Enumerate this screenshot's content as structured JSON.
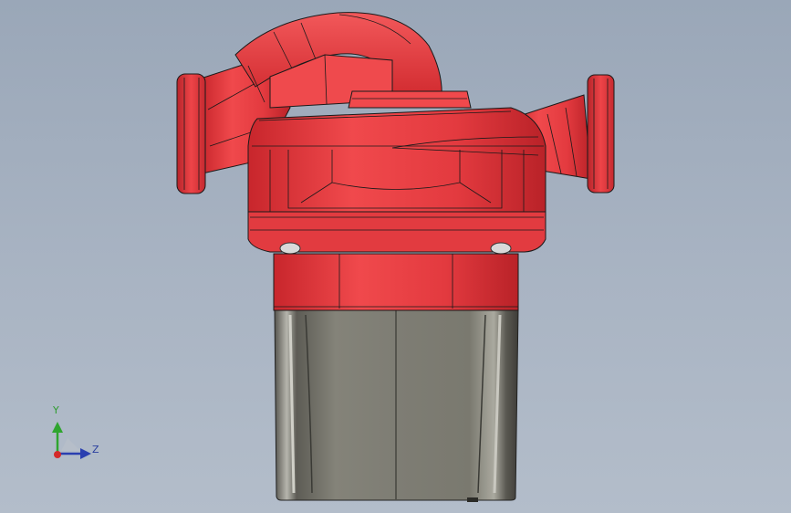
{
  "viewport": {
    "background_top": "#9aa7b8",
    "background_bottom": "#b3bdca"
  },
  "model": {
    "part": "circulation-pump",
    "body_color": "#e8383d",
    "body_shadow_color": "#b8242a",
    "motor_can_color": "#7d7c73"
  },
  "triad": {
    "y_label": "Y",
    "z_label": "Z",
    "y_color": "#2fa52f",
    "z_color": "#2a3fb0",
    "x_color": "#d42a2a"
  }
}
